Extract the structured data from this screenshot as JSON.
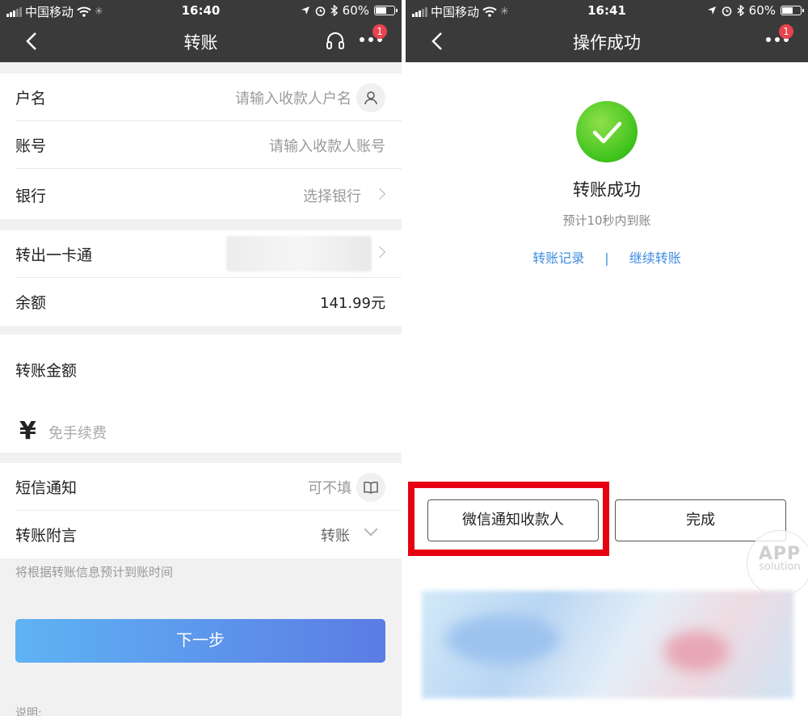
{
  "left": {
    "status": {
      "carrier": "中国移动",
      "time": "16:40",
      "battery": "60%",
      "battery_level": 0.6
    },
    "nav": {
      "title": "转账",
      "badge": "1"
    },
    "form": {
      "payee_label": "户名",
      "payee_placeholder": "请输入收款人户名",
      "account_label": "账号",
      "account_placeholder": "请输入收款人账号",
      "bank_label": "银行",
      "bank_placeholder": "选择银行",
      "from_label": "转出一卡通",
      "balance_label": "余额",
      "balance_value": "141.99元",
      "amount_label": "转账金额",
      "currency_symbol": "¥",
      "amount_placeholder": "免手续费",
      "sms_label": "短信通知",
      "sms_placeholder": "可不填",
      "memo_label": "转账附言",
      "memo_value": "转账"
    },
    "hint": "将根据转账信息预计到账时间",
    "next_button": "下一步",
    "note_label": "说明:"
  },
  "right": {
    "status": {
      "carrier": "中国移动",
      "time": "16:41",
      "battery": "60%",
      "battery_level": 0.6
    },
    "nav": {
      "title": "操作成功",
      "badge": "1"
    },
    "success_title": "转账成功",
    "success_subtitle": "预计10秒内到账",
    "links": {
      "records": "转账记录",
      "separator": "|",
      "continue": "继续转账"
    },
    "buttons": {
      "wechat_notify": "微信通知收款人",
      "done": "完成"
    },
    "watermark": {
      "line1": "APP",
      "line2": "solution"
    }
  },
  "colors": {
    "nav_bg": "#3a3a3a",
    "accent_blue": "#3f8ce2",
    "highlight_red": "#e60012",
    "success_green": "#3ec21c",
    "badge_red": "#e8434e"
  }
}
